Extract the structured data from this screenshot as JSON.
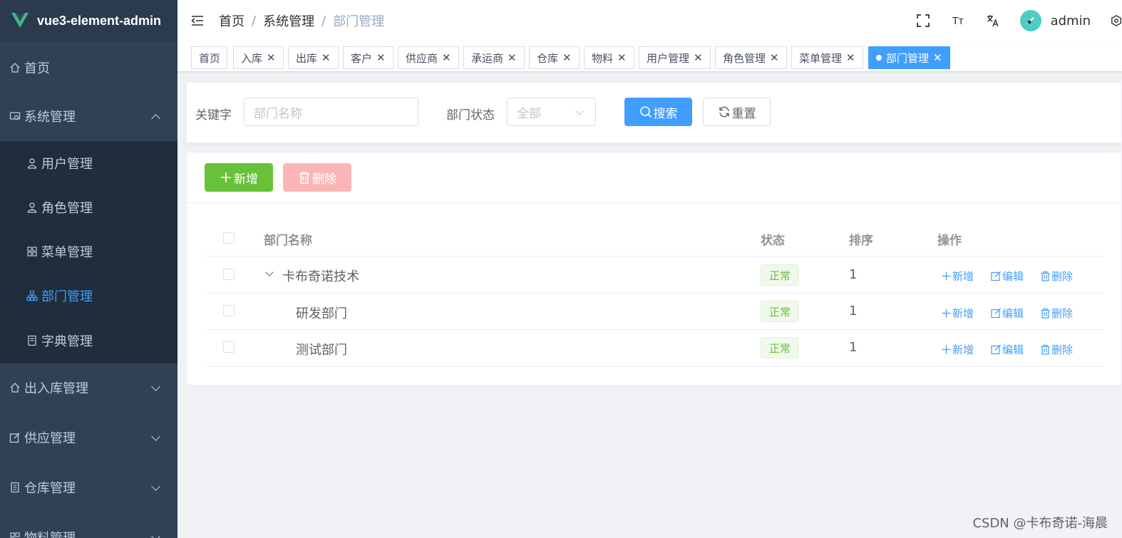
{
  "app": {
    "title": "vue3-element-admin"
  },
  "sidebar": {
    "items": [
      {
        "label": "首页",
        "icon": "home-icon"
      },
      {
        "label": "系统管理",
        "icon": "system-icon"
      },
      {
        "label": "用户管理",
        "icon": "user-icon"
      },
      {
        "label": "角色管理",
        "icon": "role-icon"
      },
      {
        "label": "菜单管理",
        "icon": "menu-icon"
      },
      {
        "label": "部门管理",
        "icon": "tree-icon"
      },
      {
        "label": "字典管理",
        "icon": "dict-icon"
      },
      {
        "label": "出入库管理",
        "icon": "home-icon"
      },
      {
        "label": "供应管理",
        "icon": "edit-icon"
      },
      {
        "label": "仓库管理",
        "icon": "doc-icon"
      },
      {
        "label": "物料管理",
        "icon": "material-icon"
      }
    ],
    "active_color": "#409eff"
  },
  "navbar": {
    "breadcrumb": [
      "首页",
      "系统管理",
      "部门管理"
    ],
    "separator": "/",
    "size_icon_text": "Tт",
    "username": "admin"
  },
  "tags": [
    {
      "label": "首页",
      "closable": false
    },
    {
      "label": "入库",
      "closable": true
    },
    {
      "label": "出库",
      "closable": true
    },
    {
      "label": "客户",
      "closable": true
    },
    {
      "label": "供应商",
      "closable": true
    },
    {
      "label": "承运商",
      "closable": true
    },
    {
      "label": "仓库",
      "closable": true
    },
    {
      "label": "物料",
      "closable": true
    },
    {
      "label": "用户管理",
      "closable": true
    },
    {
      "label": "角色管理",
      "closable": true
    },
    {
      "label": "菜单管理",
      "closable": true
    },
    {
      "label": "部门管理",
      "closable": true,
      "active": true
    }
  ],
  "search": {
    "keyword_label": "关键字",
    "keyword_placeholder": "部门名称",
    "status_label": "部门状态",
    "status_value": "全部",
    "search_button": "搜索",
    "reset_button": "重置"
  },
  "toolbar": {
    "add_button": "新增",
    "delete_button": "删除"
  },
  "table": {
    "columns": [
      "部门名称",
      "状态",
      "排序",
      "操作"
    ],
    "rows": [
      {
        "name": "卡布奇诺技术",
        "status": "正常",
        "sort": "1",
        "expanded": true,
        "level": 0
      },
      {
        "name": "研发部门",
        "status": "正常",
        "sort": "1",
        "level": 1
      },
      {
        "name": "测试部门",
        "status": "正常",
        "sort": "1",
        "level": 1
      }
    ],
    "actions": {
      "add": "新增",
      "edit": "编辑",
      "delete": "删除"
    }
  },
  "watermark": "CSDN @卡布奇诺-海晨",
  "colors": {
    "primary": "#409eff",
    "success": "#67c23a",
    "danger_disabled": "#fab6b6",
    "sidebar_bg": "#304156"
  }
}
